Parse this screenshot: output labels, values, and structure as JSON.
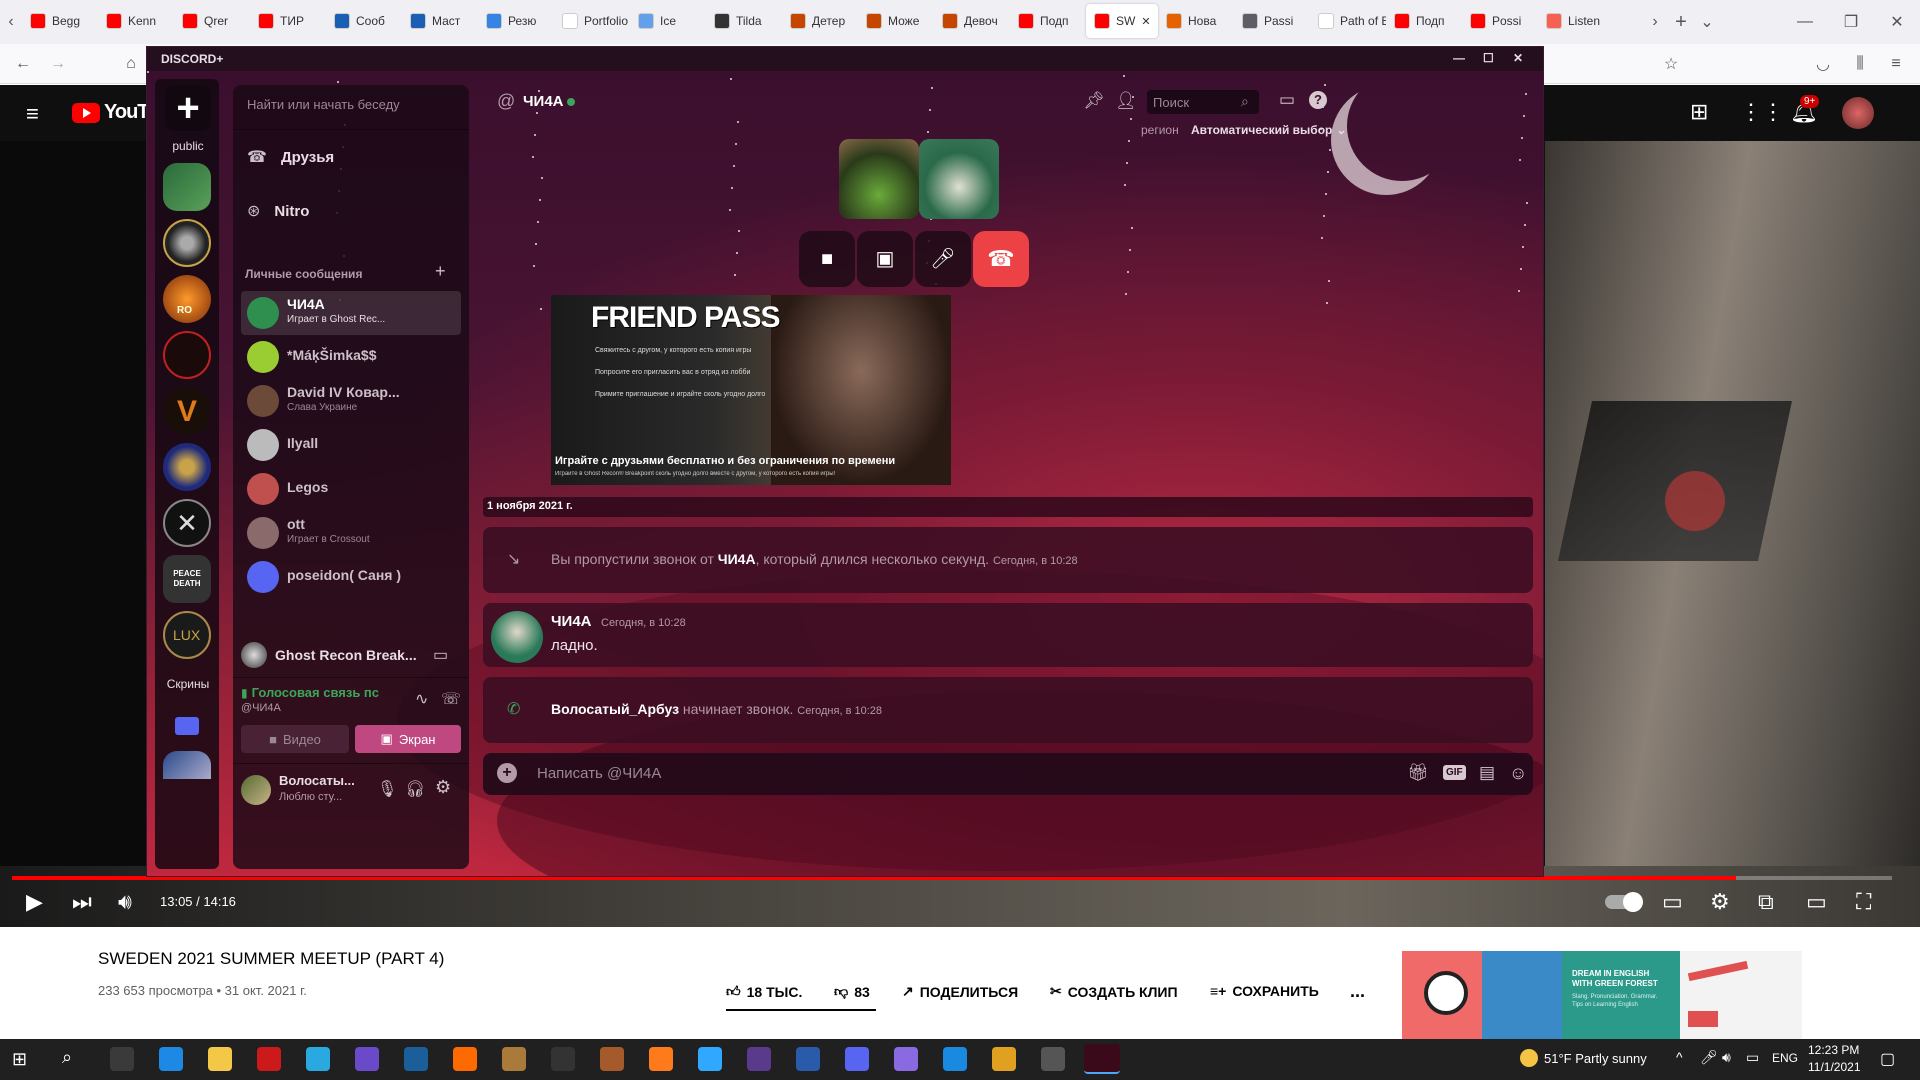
{
  "browser": {
    "tabs": [
      {
        "label": "Begg",
        "color": "#ff0000"
      },
      {
        "label": "Kenn",
        "color": "#ff0000"
      },
      {
        "label": "Qrer",
        "color": "#ff0000"
      },
      {
        "label": "ТИР",
        "color": "#ff0000"
      },
      {
        "label": "Сооб",
        "color": "#1a5fb4"
      },
      {
        "label": "Маст",
        "color": "#1a5fb4"
      },
      {
        "label": "Резю",
        "color": "#3584e4"
      },
      {
        "label": "Portfolio",
        "color": "#ffffff"
      },
      {
        "label": "Ice",
        "color": "#62a0ea"
      },
      {
        "label": "Tilda",
        "color": "#333333"
      },
      {
        "label": "Детер",
        "color": "#c64600"
      },
      {
        "label": "Може",
        "color": "#c64600"
      },
      {
        "label": "Девоч",
        "color": "#c64600"
      },
      {
        "label": "Подп",
        "color": "#ff0000"
      },
      {
        "label": "SW",
        "color": "#ff0000",
        "active": true
      },
      {
        "label": "Нова",
        "color": "#e66100"
      },
      {
        "label": "Passi",
        "color": "#5e5c64"
      },
      {
        "label": "Path of B",
        "color": "#ffffff"
      },
      {
        "label": "Подп",
        "color": "#ff0000"
      },
      {
        "label": "Possi",
        "color": "#ff0000"
      },
      {
        "label": "Listen",
        "color": "#f66151"
      }
    ]
  },
  "youtube": {
    "logo_text": "YouTube",
    "notif_badge": "9+",
    "time": "13:05 / 14:16",
    "progress": 0.917,
    "video_title": "SWEDEN 2021 SUMMER MEETUP (PART 4)",
    "stats": "233 653 просмотра • 31 окт. 2021 г.",
    "likes": "18 ТЫС.",
    "dislikes": "83",
    "share": "ПОДЕЛИТЬСЯ",
    "clip": "СОЗДАТЬ КЛИП",
    "save": "СОХРАНИТЬ",
    "more": "...",
    "ad_title": "DREAM IN ENGLISH WITH GREEN FOREST",
    "ad_sub": "Slang. Pronunciation. Grammar. Tips on Learning English"
  },
  "discord": {
    "window_title": "DISCORD+",
    "server_label_public": "public",
    "server_label_screens": "Скрины",
    "server_icon_texts": {
      "ro": "RO",
      "peace": "PEACE DEATH",
      "lux": "LUX",
      "v": "V"
    },
    "search_placeholder": "Найти или начать беседу",
    "nav_friends": "Друзья",
    "nav_nitro": "Nitro",
    "dm_header": "Личные сообщения",
    "dm_add": "+",
    "dms": [
      {
        "name": "ЧИ4А",
        "sub": "Играет в Ghost Rec...",
        "color": "#2f8f4f",
        "active": true
      },
      {
        "name": "*MáķŠimka$$",
        "sub": "",
        "color": "#9acd32"
      },
      {
        "name": "David IV Ковар...",
        "sub": "Слава Украине",
        "color": "#6b4a3a"
      },
      {
        "name": "Ilyall",
        "sub": "",
        "color": "#bbbbbb"
      },
      {
        "name": "Legos",
        "sub": "",
        "color": "#c0504d"
      },
      {
        "name": "ott",
        "sub": "Играет в Crossout",
        "color": "#8a6a6a"
      },
      {
        "name": "poseidon( Саня )",
        "sub": "",
        "color": "#5865f2"
      }
    ],
    "game_activity": "Ghost Recon Break...",
    "voice_status": "Голосовая связь пс",
    "voice_user": "@ЧИ4А",
    "btn_video": "Видео",
    "btn_screen": "Экран",
    "user_name": "Волосаты...",
    "user_status": "Люблю сту...",
    "chat_user": "ЧИ4А",
    "chat_search": "Поиск",
    "region_label": "регион",
    "region_value": "Автоматический выбор",
    "friend_pass": {
      "title": "FRIEND PASS",
      "lines": [
        "Свяжитесь с другом, у которого есть копия игры",
        "Попросите его пригласить вас в отряд из лобби",
        "Примите приглашение и играйте сколь угодно долго"
      ],
      "caption": "Играйте с друзьями бесплатно и без ограничения по времени",
      "small": "Играйте в Ghost Recon® Breakpoint сколь угодно долго вместе с другом, у которого есть копия игры!"
    },
    "date_divider": "1 ноября 2021 г.",
    "missed_call": {
      "prefix": "Вы пропустили звонок от",
      "user": "ЧИ4А",
      "suffix": ", который длился несколько секунд.",
      "time": "Сегодня, в 10:28"
    },
    "message": {
      "author": "ЧИ4А",
      "time": "Сегодня, в 10:28",
      "text": "ладно."
    },
    "call_start": {
      "user": "Волосатый_Арбуз",
      "text": "начинает звонок.",
      "time": "Сегодня, в 10:28"
    },
    "input_placeholder": "Написать @ЧИ4А",
    "gif_label": "GIF"
  },
  "taskbar": {
    "weather": "51°F  Partly sunny",
    "lang": "ENG",
    "time": "12:23 PM",
    "date": "11/1/2021"
  }
}
